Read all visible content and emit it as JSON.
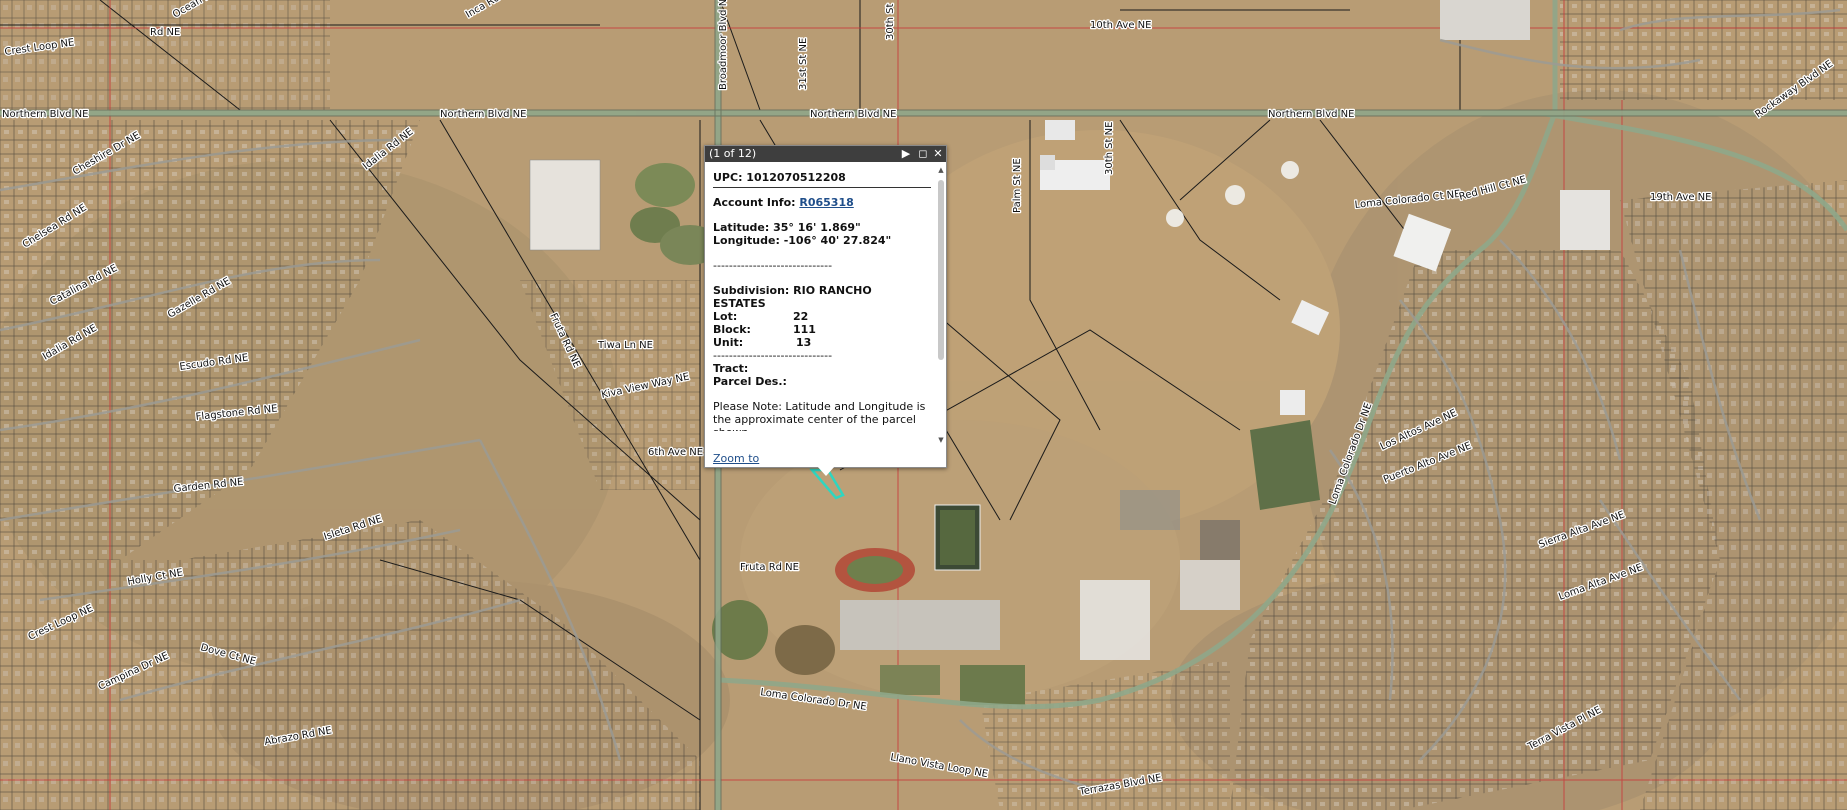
{
  "popup": {
    "title": "(1 of 12)",
    "next_icon": "play-next-icon",
    "maximize_icon": "maximize-icon",
    "close_icon": "close-icon",
    "upc": "UPC: 1012070512208",
    "account_label": "Account Info: ",
    "account_link": "R065318",
    "latitude": "Latitude: 35° 16' 1.869\"",
    "longitude": "Longitude: -106° 40' 27.824\"",
    "divider": "------------------------------",
    "subdivision_line1": "Subdivision: RIO RANCHO",
    "subdivision_line2": "ESTATES",
    "lot_label": "Lot:",
    "lot_value": "22",
    "block_label": "Block:",
    "block_value": "111",
    "unit_label": "Unit:",
    "unit_value": "13",
    "tract_label": "Tract:",
    "parcel_label": "Parcel Des.:",
    "note": "Please Note: Latitude and Longitude is the approximate center of the parcel shown.",
    "zoom_link": "Zoom to"
  },
  "map": {
    "street_labels": [
      "Crest Loop NE",
      "Rd NE",
      "Ocean Rd NE",
      "Inca Rd NE",
      "Broadmoor Blvd NE",
      "31st St NE",
      "30th St",
      "10th Ave NE",
      "Northern Blvd NE",
      "Northern Blvd NE",
      "Northern Blvd NE",
      "Rockaway Blvd NE",
      "Northern Blvd NE",
      "Idalia Rd NE",
      "Cheshire Dr NE",
      "Chelsea Rd NE",
      "Catalina Rd NE",
      "Gazelle Rd NE",
      "Idalia Rd NE",
      "Escudo Rd NE",
      "Flagstone Rd NE",
      "Garden Rd NE",
      "Isleta Rd NE",
      "Holly Ct NE",
      "Dove Ct NE",
      "Abrazo Rd NE",
      "Fruta Rd NE",
      "Fruta Rd NE",
      "Tiwa Ln NE",
      "Kiva View Way NE",
      "6th Ave NE",
      "Palm St NE",
      "30th St NE",
      "Loma Colorado Ct NE",
      "Red Hill Ct NE",
      "19th Ave NE",
      "Loma Colorado Dr NE",
      "Loma Colorado Dr NE",
      "Los Altos Ave NE",
      "Puerto Alto Ave NE",
      "Sierra Alta Ave NE",
      "Loma Alta Ave NE",
      "Terra Vista Pl NE",
      "Terrazas Blvd NE",
      "Llano Vista Loop NE",
      "Crest Loop NE",
      "Campina Dr NE"
    ],
    "colors": {
      "terrain": "#b89c74",
      "parcel_lines": "#1a1a1a",
      "major_roads": "#8fa78a",
      "red_grid": "#c83a3a",
      "highlight_parcel": "#2fd6c0"
    }
  }
}
